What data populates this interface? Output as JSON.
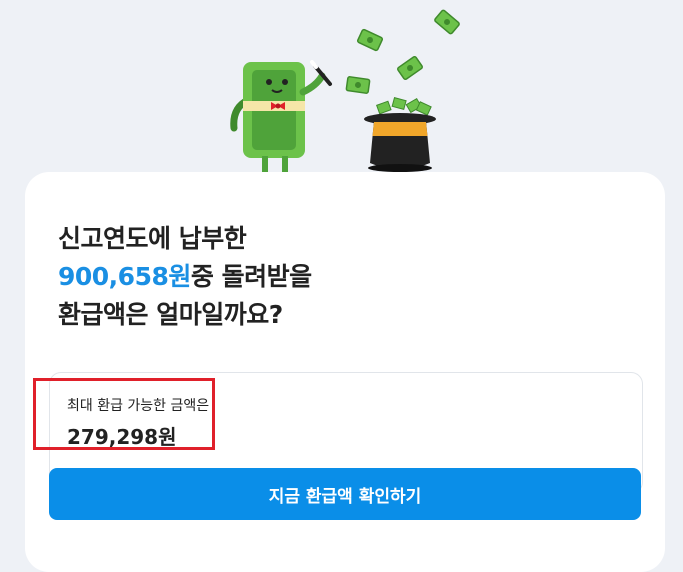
{
  "headline": {
    "line1": "신고연도에 납부한",
    "amount": "900,658원",
    "line2_rest": "중 돌려받을",
    "line3": "환급액은 얼마일까요?"
  },
  "refund": {
    "label": "최대 환급 가능한 금액은",
    "value": "279,298원"
  },
  "cta": {
    "label": "지금 환급액 확인하기"
  },
  "colors": {
    "accent": "#1a8fe3",
    "button": "#0a8ee8",
    "highlight_border": "#e0202a",
    "background": "#eef1f6"
  },
  "illustration": {
    "icons": [
      "money-mascot-icon",
      "magic-wand-icon",
      "flying-bill-icon",
      "magic-hat-icon"
    ]
  }
}
